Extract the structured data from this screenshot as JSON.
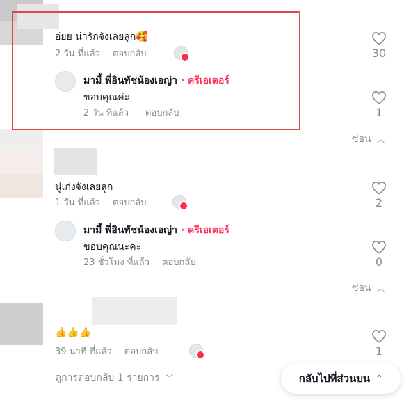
{
  "colors": {
    "accent": "#fe2c55",
    "highlight_box": "#e04848",
    "muted": "#8a8b91"
  },
  "comments": [
    {
      "text": "อ่ยย น่ารักจังเลยลูก🥰",
      "time": "2 วัน ที่แล้ว",
      "reply": "ตอบกลับ",
      "likes": "30",
      "replies": [
        {
          "author": "มามี้ พี่อินทัชน้องเอญ่า",
          "badge": "· ครีเอเตอร์",
          "text": "ขอบคุณค่ะ",
          "time": "2 วัน ที่แล้ว",
          "reply": "ตอบกลับ",
          "likes": "1"
        }
      ],
      "hide": "ซ่อน"
    },
    {
      "text": "นู่เก่งจังเลยลูก",
      "time": "1 วัน ที่แล้ว",
      "reply": "ตอบกลับ",
      "likes": "2",
      "replies": [
        {
          "author": "มามี้ พี่อินทัชน้องเอญ่า",
          "badge": "· ครีเอเตอร์",
          "text": "ขอบคุณนะคะ",
          "time": "23 ชั่วโมง ที่แล้ว",
          "reply": "ตอบกลับ",
          "likes": "0"
        }
      ],
      "hide": "ซ่อน"
    },
    {
      "text": "👍👍👍",
      "time": "39 นาที ที่แล้ว",
      "reply": "ตอบกลับ",
      "likes": "1",
      "view_replies": "ดูการตอบกลับ 1 รายการ"
    }
  ],
  "back_to_top": "กลับไปที่ส่วนบน"
}
